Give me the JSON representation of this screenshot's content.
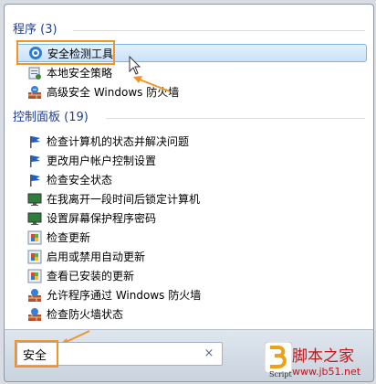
{
  "programs": {
    "header": "程序 (3)",
    "items": [
      {
        "label": "安全检测工具",
        "icon": "security-scan-icon"
      },
      {
        "label": "本地安全策略",
        "icon": "local-policy-icon"
      },
      {
        "label": "高级安全 Windows 防火墙",
        "icon": "firewall-advanced-icon"
      }
    ]
  },
  "control_panel": {
    "header": "控制面板 (19)",
    "items": [
      {
        "label": "检查计算机的状态并解决问题",
        "icon": "action-center-flag-icon"
      },
      {
        "label": "更改用户帐户控制设置",
        "icon": "action-center-flag-icon"
      },
      {
        "label": "检查安全状态",
        "icon": "action-center-flag-icon"
      },
      {
        "label": "在我离开一段时间后锁定计算机",
        "icon": "monitor-icon"
      },
      {
        "label": "设置屏幕保护程序密码",
        "icon": "monitor-icon"
      },
      {
        "label": "检查更新",
        "icon": "windows-update-icon"
      },
      {
        "label": "启用或禁用自动更新",
        "icon": "windows-update-icon"
      },
      {
        "label": "查看已安装的更新",
        "icon": "windows-update-icon"
      },
      {
        "label": "允许程序通过 Windows 防火墙",
        "icon": "firewall-icon"
      },
      {
        "label": "检查防火墙状态",
        "icon": "firewall-icon"
      }
    ]
  },
  "search": {
    "value": "安全",
    "clear_icon": "×"
  },
  "watermark": {
    "cn": "脚本之家",
    "url": "www.jb51.net",
    "script": "Script"
  },
  "colors": {
    "accent_orange": "#f09428",
    "header_blue": "#1e3f8f",
    "brand_red": "#c21416"
  }
}
